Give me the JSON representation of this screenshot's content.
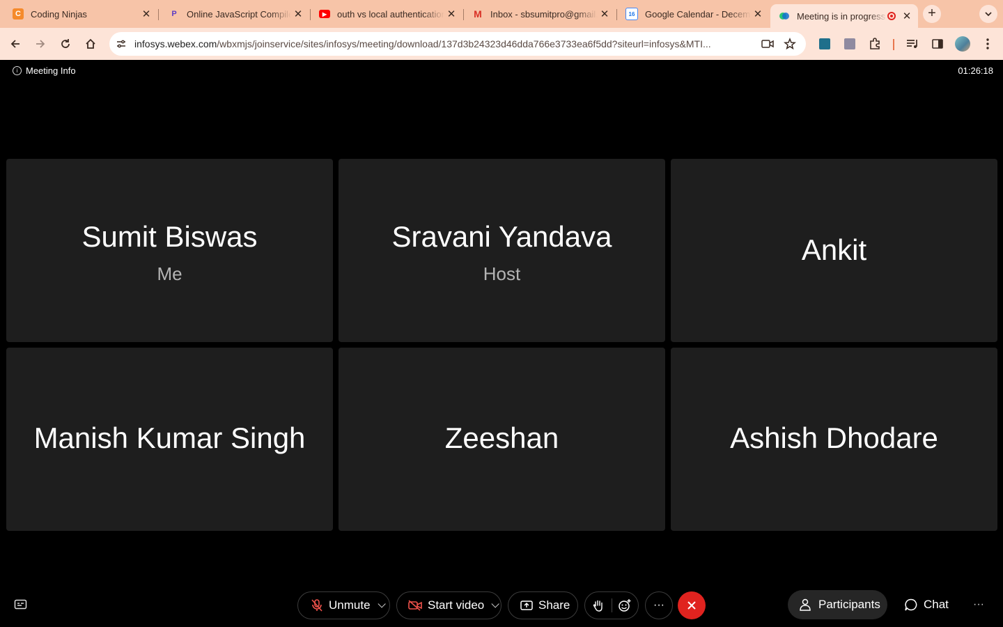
{
  "browser": {
    "tabs": [
      {
        "title": "Coding Ninjas",
        "icon": "coding-ninjas-icon"
      },
      {
        "title": "Online JavaScript Compiler",
        "icon": "programiz-icon"
      },
      {
        "title": "outh vs local authentication",
        "icon": "youtube-icon"
      },
      {
        "title": "Inbox - sbsumitpro@gmail.com",
        "icon": "gmail-icon"
      },
      {
        "title": "Google Calendar - December",
        "icon": "google-calendar-icon"
      },
      {
        "title": "Meeting is in progress",
        "icon": "webex-icon",
        "active": true
      }
    ],
    "url_host": "infosys.webex.com",
    "url_path": "/wbxmjs/joinservice/sites/infosys/meeting/download/137d3b24323d46dda766e3733ea6f5dd?siteurl=infosys&MTI..."
  },
  "meeting": {
    "info_label": "Meeting Info",
    "elapsed": "01:26:18",
    "participants": [
      {
        "name": "Sumit Biswas",
        "role": "Me"
      },
      {
        "name": "Sravani Yandava",
        "role": "Host"
      },
      {
        "name": "Ankit",
        "role": ""
      },
      {
        "name": "Manish Kumar Singh",
        "role": ""
      },
      {
        "name": "Zeeshan",
        "role": ""
      },
      {
        "name": "Ashish Dhodare",
        "role": ""
      }
    ]
  },
  "controls": {
    "unmute": "Unmute",
    "start_video": "Start video",
    "share": "Share",
    "participants": "Participants",
    "chat": "Chat",
    "more": "···"
  },
  "colors": {
    "tabbar": "#f7c4a8",
    "toolbar": "#fde4d8",
    "tile": "#1e1e1e",
    "end_call": "#e0231f",
    "muted_red": "#f0524b"
  }
}
